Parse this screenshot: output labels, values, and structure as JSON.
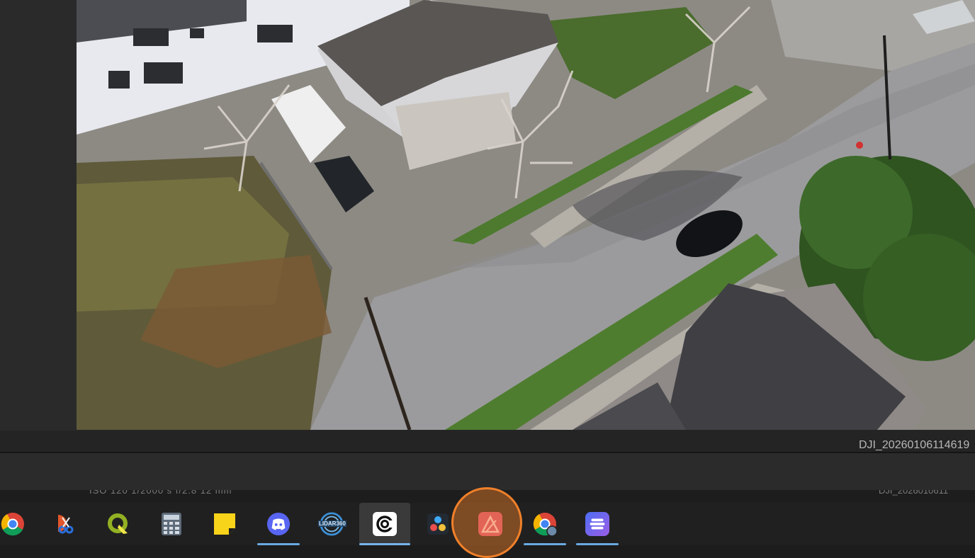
{
  "viewer": {
    "photo_alt": "Aerial drone photo of a residential street",
    "filename": "DJI_20260106114619",
    "meta_peek": "ISO 120   1/2000 s   f/2.8   12 mm",
    "filename_peek": "DJI_2026010611"
  },
  "taskbar": {
    "apps": [
      {
        "name": "Google Chrome",
        "icon": "chrome-icon"
      },
      {
        "name": "Snipping Tool",
        "icon": "snipping-tool-icon"
      },
      {
        "name": "QGIS",
        "icon": "qgis-icon"
      },
      {
        "name": "Calculator",
        "icon": "calculator-icon"
      },
      {
        "name": "Sticky Notes",
        "icon": "sticky-notes-icon"
      },
      {
        "name": "Discord",
        "icon": "discord-icon"
      },
      {
        "name": "LiDAR360",
        "icon": "lidar360-icon",
        "label": "LIDAR360"
      },
      {
        "name": "Photos Viewer",
        "icon": "viewer-app-icon"
      },
      {
        "name": "DaVinci Resolve",
        "icon": "davinci-resolve-icon"
      },
      {
        "name": "Affinity Photo",
        "icon": "affinity-photo-icon"
      },
      {
        "name": "Google Chrome (profile)",
        "icon": "chrome-profile-icon"
      },
      {
        "name": "Linear",
        "icon": "linear-app-icon"
      }
    ]
  },
  "colors": {
    "highlight": "#f0802a",
    "running_indicator": "#6aa9e0",
    "taskbar_bg": "#202020"
  }
}
